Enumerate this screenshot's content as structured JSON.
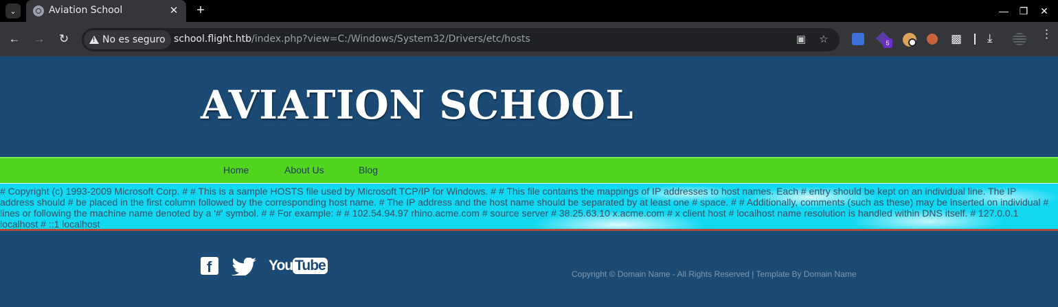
{
  "browser": {
    "tab_title": "Aviation School",
    "security_label": "No es seguro",
    "url_host": "school.flight.htb",
    "url_path": "/index.php?view=C:/Windows/System32/Drivers/etc/hosts",
    "extension_badge": "5"
  },
  "site": {
    "title": "AVIATION SCHOOL",
    "nav": [
      "Home",
      "About Us",
      "Blog"
    ],
    "hosts_content": "# Copyright (c) 1993-2009 Microsoft Corp. # # This is a sample HOSTS file used by Microsoft TCP/IP for Windows. # # This file contains the mappings of IP addresses to host names. Each # entry should be kept on an individual line. The IP address should # be placed in the first column followed by the corresponding host name. # The IP address and the host name should be separated by at least one # space. # # Additionally, comments (such as these) may be inserted on individual # lines or following the machine name denoted by a '#' symbol. # # For example: # # 102.54.94.97 rhino.acme.com # source server # 38.25.63.10 x.acme.com # x client host # localhost name resolution is handled within DNS itself. # 127.0.0.1 localhost # ::1 localhost",
    "social": {
      "facebook_icon": "facebook-icon",
      "twitter_icon": "twitter-icon",
      "youtube_logo": "YouTube"
    },
    "copyright": "Copyright © Domain Name - All Rights Reserved | Template By Domain Name"
  },
  "colors": {
    "header_bg": "#1b4a74",
    "nav_bg": "#51d41d",
    "content_bg": "#12d8f2"
  }
}
